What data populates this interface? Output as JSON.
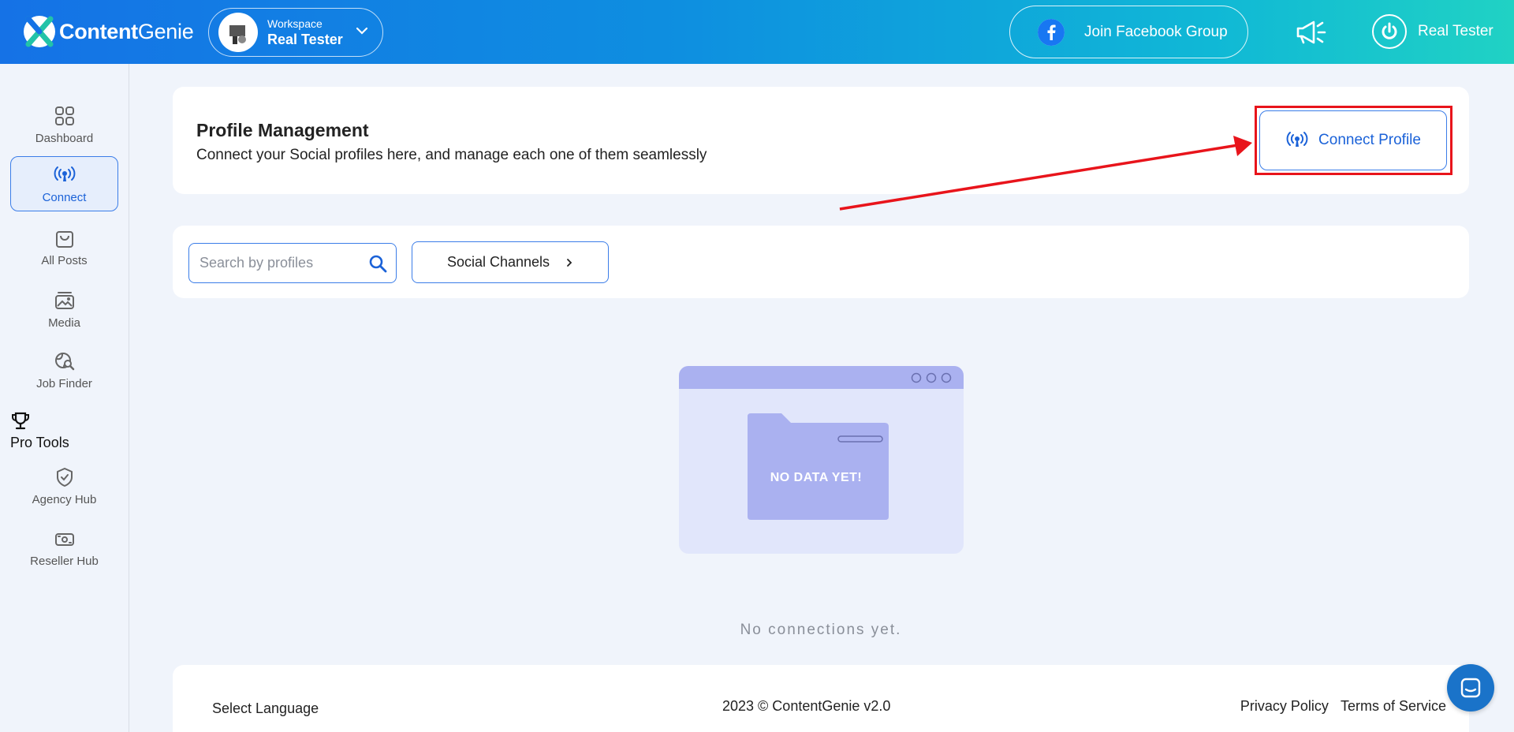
{
  "header": {
    "logo": {
      "brand_bold": "Content",
      "brand_light": "Genie"
    },
    "workspace": {
      "label": "Workspace",
      "name": "Real Tester"
    },
    "facebook_button": "Join Facebook Group",
    "user_name": "Real Tester"
  },
  "sidebar": {
    "items": [
      {
        "label": "Dashboard",
        "icon": "grid-icon"
      },
      {
        "label": "Connect",
        "icon": "broadcast-icon",
        "active": true
      },
      {
        "label": "All Posts",
        "icon": "bag-icon"
      },
      {
        "label": "Media",
        "icon": "image-stack-icon"
      },
      {
        "label": "Job Finder",
        "icon": "globe-search-icon"
      }
    ],
    "pro_tools": "Pro Tools",
    "pro_items": [
      {
        "label": "Agency Hub",
        "icon": "shield-check-icon"
      },
      {
        "label": "Reseller Hub",
        "icon": "money-icon"
      }
    ]
  },
  "profile_management": {
    "title": "Profile Management",
    "subtitle": "Connect your Social profiles here, and manage each one of them seamlessly",
    "connect_button": "Connect Profile"
  },
  "filters": {
    "search_placeholder": "Search by profiles",
    "channels_button": "Social Channels"
  },
  "empty_state": {
    "illustration_text": "NO DATA YET!",
    "message": "No connections yet."
  },
  "footer": {
    "language": "Select Language",
    "copyright": "2023 © ContentGenie v2.0",
    "privacy": "Privacy Policy",
    "terms": "Terms of Service"
  },
  "colors": {
    "accent": "#1b62d8",
    "annotation_red": "#e8141b",
    "illustration": "#aab1f0"
  }
}
